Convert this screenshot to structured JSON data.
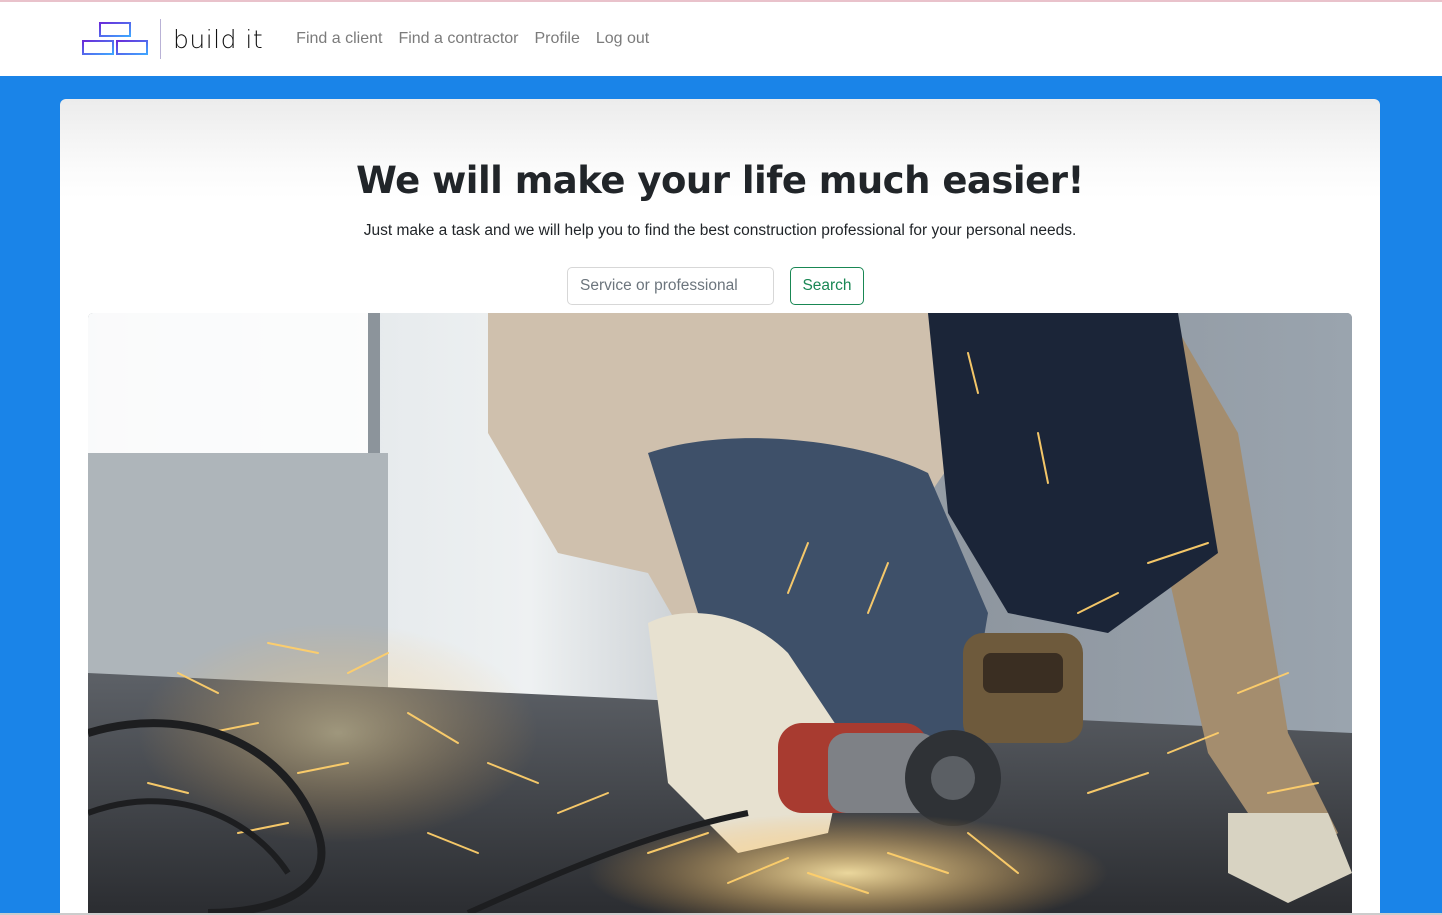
{
  "app": {
    "brand_name": "build it",
    "logo_icon": "stacked-bricks-icon"
  },
  "nav": {
    "links": [
      {
        "label": "Find a client"
      },
      {
        "label": "Find a contractor"
      },
      {
        "label": "Profile"
      },
      {
        "label": "Log out"
      }
    ]
  },
  "hero": {
    "title": "We will make your life much easier!",
    "subtitle": "Just make a task and we will help you to find the best construction professional for your personal needs.",
    "search": {
      "placeholder": "Service or professional",
      "value": "",
      "button_label": "Search"
    },
    "image_subject": "worker-angle-grinder-sparks-photo"
  },
  "colors": {
    "page_background": "#1a84e8",
    "navbar_background": "#ffffff",
    "search_button_accent": "#198754",
    "logo_gradient_start": "#6a2bd9",
    "logo_gradient_end": "#3fa6ff"
  }
}
